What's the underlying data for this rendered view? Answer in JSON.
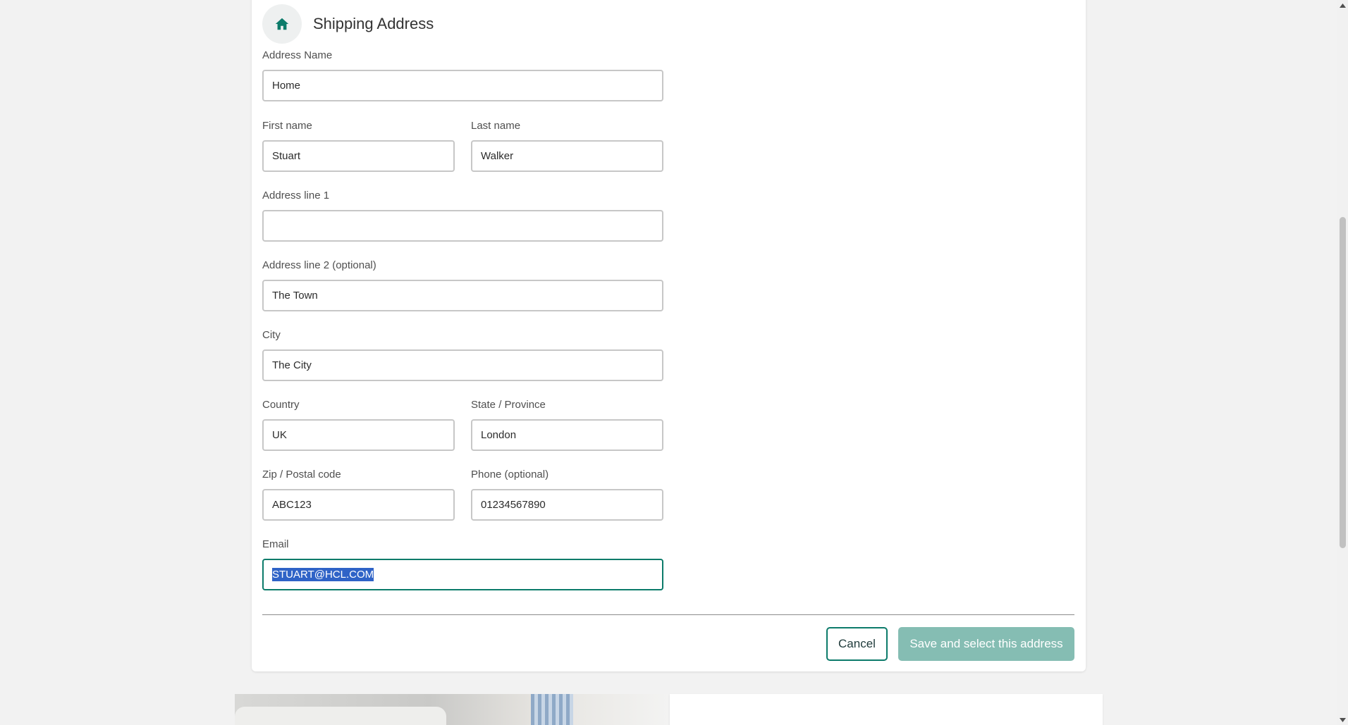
{
  "form": {
    "title": "Shipping Address",
    "icon": "home-icon",
    "accent_color": "#0c7b6a",
    "fields": {
      "address_name": {
        "label": "Address Name",
        "value": "Home"
      },
      "first_name": {
        "label": "First name",
        "value": "Stuart"
      },
      "last_name": {
        "label": "Last name",
        "value": "Walker"
      },
      "address_line_1": {
        "label": "Address line 1",
        "value": ""
      },
      "address_line_2": {
        "label": "Address line 2 (optional)",
        "value": "The Town"
      },
      "city": {
        "label": "City",
        "value": "The City"
      },
      "country": {
        "label": "Country",
        "value": "UK"
      },
      "state": {
        "label": "State / Province",
        "value": "London"
      },
      "zip": {
        "label": "Zip / Postal code",
        "value": "ABC123"
      },
      "phone": {
        "label": "Phone (optional)",
        "value": "01234567890"
      },
      "email": {
        "label": "Email",
        "value": "STUART@HCL.COM"
      }
    },
    "actions": {
      "cancel_label": "Cancel",
      "save_label": "Save and select this address",
      "save_color": "#85bdb3"
    }
  }
}
